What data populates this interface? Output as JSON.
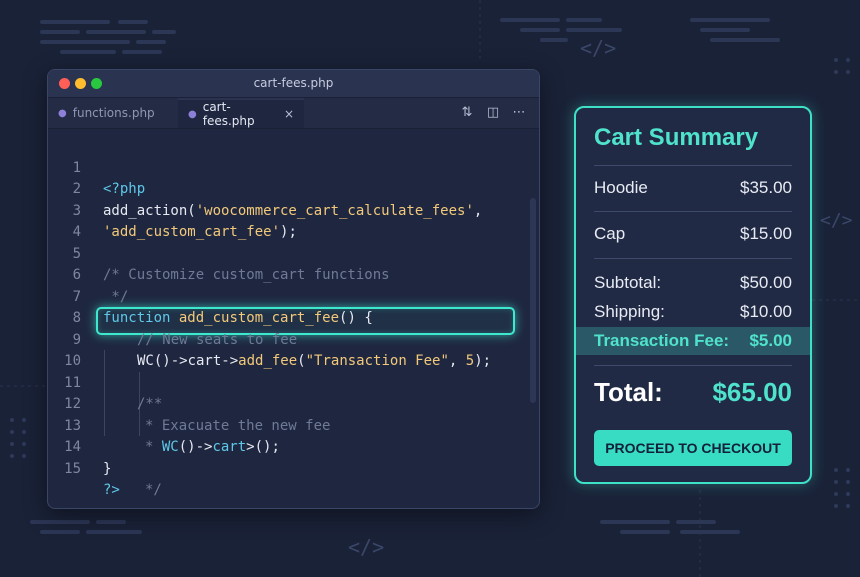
{
  "editor": {
    "window_title": "cart-fees.php",
    "tabs": [
      {
        "label": "functions.php",
        "active": false
      },
      {
        "label": "cart-fees.php",
        "active": true
      }
    ],
    "tab_close": "×",
    "code_lines": [
      {
        "n": "1"
      },
      {
        "n": "2"
      },
      {
        "n": "3"
      },
      {
        "n": "4"
      },
      {
        "n": "5"
      },
      {
        "n": "6"
      },
      {
        "n": "7"
      },
      {
        "n": "8"
      },
      {
        "n": "9"
      },
      {
        "n": "10"
      },
      {
        "n": "11"
      },
      {
        "n": "12"
      },
      {
        "n": "13"
      },
      {
        "n": "14"
      },
      {
        "n": "15"
      }
    ],
    "code": {
      "l1": "<?php",
      "l2_a": "add_action(",
      "l2_b": "'woocommerce_cart_calculate_fees'",
      "l2_c": ",",
      "l3_a": "'add_custom_cart_fee'",
      "l3_b": ");",
      "l5": "/* Customize custom_cart functions",
      "l6": " */",
      "l7_kw": "function",
      "l7_fn": "add_custom_cart_fee",
      "l7_rest": "() {",
      "l8": "// New seats to fee",
      "l9_a": "WC()->cart->",
      "l9_fn": "add_fee",
      "l9_b": "(",
      "l9_str": "\"Transaction Fee\"",
      "l9_c": ", ",
      "l9_num": "5",
      "l9_d": ");",
      "l11": "/**",
      "l12": "* Exacuate the new fee",
      "l13_a": "* ",
      "l13_kw": "WC",
      "l13_b": "()->",
      "l13_kw2": "cart",
      "l13_c": ">();",
      "l14_a": "}",
      "l14_b": "*/",
      "l15": "?>"
    },
    "highlighted_line": 9
  },
  "cart": {
    "title": "Cart Summary",
    "items": [
      {
        "name": "Hoodie",
        "price": "$35.00"
      },
      {
        "name": "Cap",
        "price": "$15.00"
      }
    ],
    "subtotal_label": "Subtotal:",
    "subtotal": "$50.00",
    "shipping_label": "Shipping:",
    "shipping": "$10.00",
    "fee_label": "Transaction Fee:",
    "fee": "$5.00",
    "total_label": "Total:",
    "total": "$65.00",
    "checkout_label": "PROCEED TO CHECKOUT"
  },
  "decor": {
    "code_glyph": "</>"
  },
  "colors": {
    "accent": "#3ee0c6",
    "background": "#1a2238"
  }
}
